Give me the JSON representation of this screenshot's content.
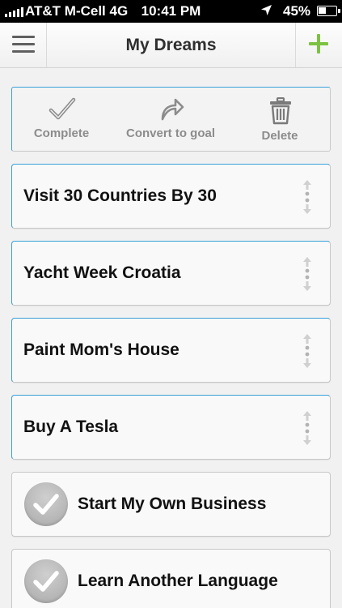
{
  "status_bar": {
    "carrier": "AT&T M-Cell",
    "network": "4G",
    "time": "10:41 PM",
    "battery_percent": "45%",
    "battery_level": 0.45,
    "location_icon": "location-arrow-icon"
  },
  "nav": {
    "title": "My Dreams",
    "menu_icon": "hamburger-menu-icon",
    "add_icon": "plus-icon"
  },
  "actions": [
    {
      "label": "Complete",
      "icon": "checkmark-icon"
    },
    {
      "label": "Convert to goal",
      "icon": "redo-arrow-icon"
    },
    {
      "label": "Delete",
      "icon": "trash-icon"
    }
  ],
  "dreams": [
    {
      "title": "Visit 30 Countries By 30",
      "completed": false
    },
    {
      "title": "Yacht Week Croatia",
      "completed": false
    },
    {
      "title": "Paint Mom's House",
      "completed": false
    },
    {
      "title": "Buy A Tesla",
      "completed": false
    },
    {
      "title": "Start My Own Business",
      "completed": true
    },
    {
      "title": "Learn Another Language",
      "completed": true
    }
  ],
  "colors": {
    "accent_blue": "#3ba0d9",
    "add_green": "#7cc242",
    "icon_gray": "#8c8c8c"
  }
}
